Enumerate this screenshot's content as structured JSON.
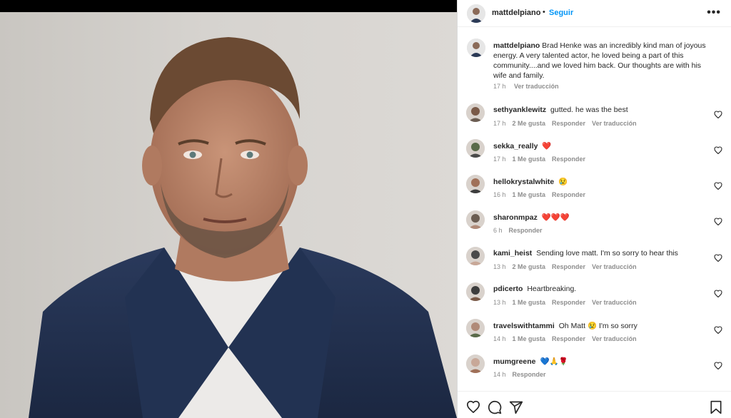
{
  "post": {
    "username": "mattdelpiano",
    "dot": "•",
    "follow_label": "Seguir",
    "more_label": "•••"
  },
  "caption": {
    "username": "mattdelpiano",
    "text": "Brad Henke was an incredibly kind man of joyous energy. A very talented actor, he loved being a part of this community....and we loved him back. Our thoughts are with his wife and family.",
    "time": "17 h",
    "translate": "Ver traducción"
  },
  "comments": [
    {
      "username": "sethyanklewitz",
      "text": "gutted. he was the best",
      "emoji": "",
      "time": "17 h",
      "likes": "2 Me gusta",
      "reply": "Responder",
      "translate": "Ver traducción"
    },
    {
      "username": "sekka_really",
      "text": "",
      "emoji": "❤️",
      "time": "17 h",
      "likes": "1 Me gusta",
      "reply": "Responder",
      "translate": ""
    },
    {
      "username": "hellokrystalwhite",
      "text": "",
      "emoji": "😢",
      "time": "16 h",
      "likes": "1 Me gusta",
      "reply": "Responder",
      "translate": ""
    },
    {
      "username": "sharonmpaz",
      "text": "",
      "emoji": "❤️❤️❤️",
      "time": "6 h",
      "likes": "",
      "reply": "Responder",
      "translate": ""
    },
    {
      "username": "kami_heist",
      "text": "Sending love matt. I'm so sorry to hear this",
      "emoji": "",
      "time": "13 h",
      "likes": "2 Me gusta",
      "reply": "Responder",
      "translate": "Ver traducción"
    },
    {
      "username": "pdicerto",
      "text": "Heartbreaking.",
      "emoji": "",
      "time": "13 h",
      "likes": "1 Me gusta",
      "reply": "Responder",
      "translate": "Ver traducción"
    },
    {
      "username": "travelswithtammi",
      "text": "Oh Matt 😢 I'm so sorry",
      "emoji": "",
      "time": "14 h",
      "likes": "1 Me gusta",
      "reply": "Responder",
      "translate": "Ver traducción"
    },
    {
      "username": "mumgreene",
      "text": "",
      "emoji": "💙🙏🌹",
      "time": "14 h",
      "likes": "",
      "reply": "Responder",
      "translate": ""
    }
  ],
  "icons": {
    "like": "heart-icon",
    "comment": "comment-icon",
    "share": "share-icon",
    "save": "bookmark-icon"
  },
  "colors": {
    "accent": "#0095f6",
    "text": "#262626",
    "muted": "#8e8e8e"
  }
}
